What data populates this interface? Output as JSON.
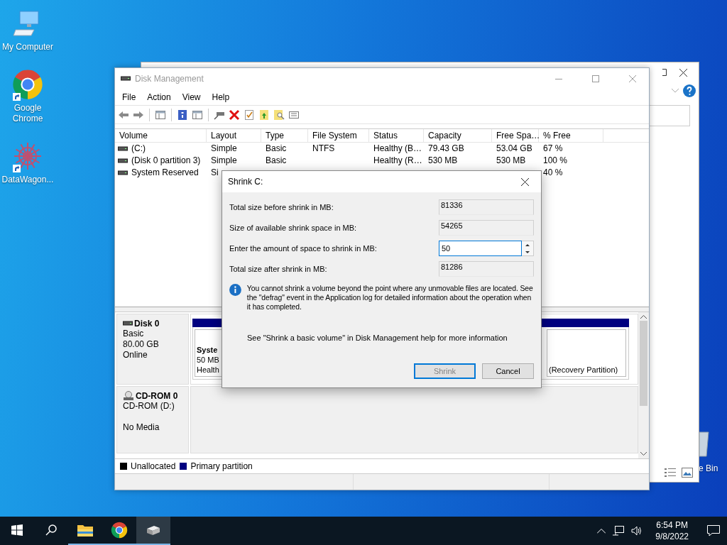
{
  "desktop_icons": [
    {
      "kind": "computer",
      "label": "My Computer"
    },
    {
      "kind": "chrome",
      "label": "Google Chrome"
    },
    {
      "kind": "datawagon",
      "label": "DataWagon..."
    }
  ],
  "recycle_bin": {
    "label": "e Bin"
  },
  "window": {
    "title": "Disk Management",
    "menu": [
      "File",
      "Action",
      "View",
      "Help"
    ],
    "toolbar": [
      {
        "kind": "back"
      },
      {
        "kind": "forward"
      },
      {
        "kind": "sep"
      },
      {
        "kind": "panel"
      },
      {
        "kind": "sep"
      },
      {
        "kind": "help"
      },
      {
        "kind": "panel"
      },
      {
        "kind": "sep"
      },
      {
        "kind": "connect"
      },
      {
        "kind": "delete"
      },
      {
        "kind": "check"
      },
      {
        "kind": "folder-up"
      },
      {
        "kind": "folder-search"
      },
      {
        "kind": "list"
      }
    ],
    "columns": [
      "Volume",
      "Layout",
      "Type",
      "File System",
      "Status",
      "Capacity",
      "Free Spa…",
      "% Free"
    ],
    "rows": [
      [
        "(C:)",
        "Simple",
        "Basic",
        "NTFS",
        "Healthy (B…",
        "79.43 GB",
        "53.04 GB",
        "67 %"
      ],
      [
        "(Disk 0 partition 3)",
        "Simple",
        "Basic",
        null,
        "Healthy (R…",
        "530 MB",
        "530 MB",
        "100 %"
      ],
      [
        "System Reserved",
        "Si",
        null,
        null,
        null,
        null,
        null,
        "40 %"
      ]
    ],
    "disks": [
      {
        "kind": "disk",
        "name": "Disk 0",
        "lines": [
          "Basic",
          "80.00 GB",
          "Online"
        ],
        "partitions": [
          {
            "title": "Syste",
            "lines": [
              "50 MB",
              "Health"
            ]
          },
          {
            "lines": [
              "(Recovery Partition)"
            ]
          }
        ]
      },
      {
        "kind": "cdrom",
        "name": "CD-ROM 0",
        "lines": [
          "CD-ROM (D:)",
          "No Media"
        ]
      }
    ],
    "legend": [
      {
        "label": "Unallocated",
        "color": "#000000"
      },
      {
        "label": "Primary partition",
        "color": "#000080"
      }
    ]
  },
  "dialog": {
    "title": "Shrink C:",
    "fields": [
      {
        "label": "Total size before shrink in MB:",
        "value": "81336",
        "kind": "readonly",
        "focused": false
      },
      {
        "label": "Size of available shrink space in MB:",
        "value": "54265",
        "kind": "readonly",
        "focused": false
      },
      {
        "label": "Enter the amount of space to shrink in MB:",
        "value": "50",
        "kind": "spin",
        "focused": true
      },
      {
        "label": "Total size after shrink in MB:",
        "value": "81286",
        "kind": "readonly",
        "focused": false
      }
    ],
    "info": "You cannot shrink a volume beyond the point where any unmovable files are located. See the \"defrag\" event in the Application log for detailed information about the operation when it has completed.",
    "help": "See \"Shrink a basic volume\" in Disk Management help for more information",
    "buttons": [
      {
        "label": "Shrink",
        "default": true,
        "disabled": true
      },
      {
        "label": "Cancel",
        "default": false,
        "disabled": false
      }
    ]
  },
  "taskbar": {
    "apps": [
      {
        "kind": "explorer",
        "selected": false
      },
      {
        "kind": "chrome",
        "selected": false
      },
      {
        "kind": "diskmgmt",
        "selected": true
      }
    ],
    "clock": {
      "time": "6:54 PM",
      "date": "9/8/2022"
    }
  }
}
